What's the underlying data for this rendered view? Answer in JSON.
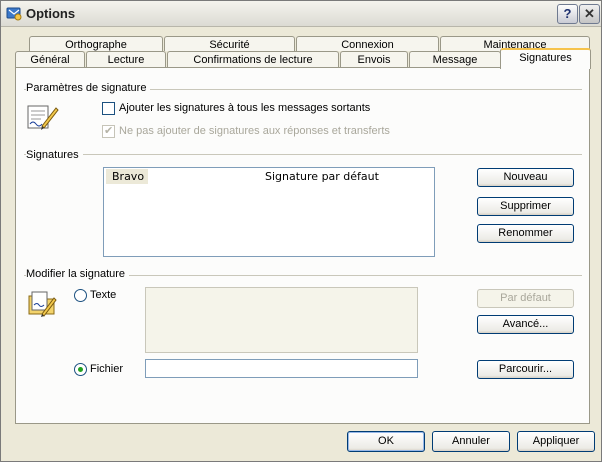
{
  "window": {
    "title": "Options",
    "help_label": "?",
    "close_label": "✕"
  },
  "tabs": {
    "row1": [
      "Orthographe",
      "Sécurité",
      "Connexion",
      "Maintenance"
    ],
    "row2": [
      "Général",
      "Lecture",
      "Confirmations de lecture",
      "Envois",
      "Message",
      "Signatures"
    ],
    "active": "Signatures"
  },
  "sig_params": {
    "title": "Paramètres de signature",
    "add_all_label": "Ajouter les signatures à tous les messages sortants",
    "no_reply_label": "Ne pas ajouter de signatures aux réponses et transferts"
  },
  "signatures": {
    "title": "Signatures",
    "items": [
      {
        "name": "Bravo",
        "status": "Signature par défaut"
      }
    ],
    "new_label": "Nouveau",
    "delete_label": "Supprimer",
    "rename_label": "Renommer"
  },
  "edit": {
    "title": "Modifier la signature",
    "text_label": "Texte",
    "file_label": "Fichier",
    "default_label": "Par défaut",
    "advanced_label": "Avancé...",
    "browse_label": "Parcourir...",
    "file_value": ""
  },
  "footer": {
    "ok_label": "OK",
    "cancel_label": "Annuler",
    "apply_label": "Appliquer"
  },
  "icons": [
    "options-app-icon",
    "signature-pen-icon",
    "edit-signature-icon"
  ]
}
